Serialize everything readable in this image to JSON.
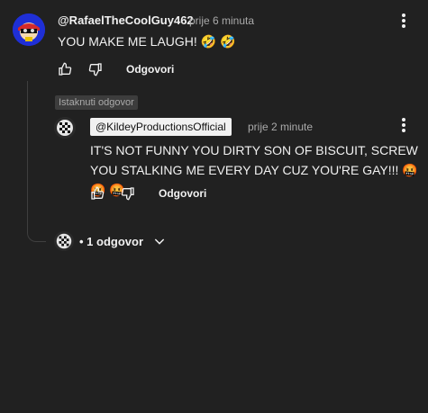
{
  "comment": {
    "author": "@RafaelTheCoolGuy462",
    "time": "prije 6 minuta",
    "text": "YOU MAKE ME LAUGH! 🤣 🤣",
    "reply_label": "Odgovori"
  },
  "reply": {
    "badge": "Istaknuti odgovor",
    "author": "@KildeyProductionsOfficial",
    "time": "prije 2 minute",
    "text": "IT'S NOT FUNNY YOU DIRTY SON OF BISCUIT, SCREW YOU STALKING ME EVERY DAY CUZ YOU'RE GAY!!! 🤬 🤬 🤬",
    "reply_label": "Odgovori"
  },
  "replies_toggle": {
    "label": "• 1 odgovor"
  },
  "icons": {
    "like": "thumb-up-icon",
    "dislike": "thumb-down-icon",
    "menu": "more-vert-icon",
    "expand": "chevron-down-icon"
  },
  "colors": {
    "background": "#212121",
    "text": "#f1f1f1",
    "secondary_text": "#aaaaaa",
    "avatar_main": "#1f2fd6"
  }
}
